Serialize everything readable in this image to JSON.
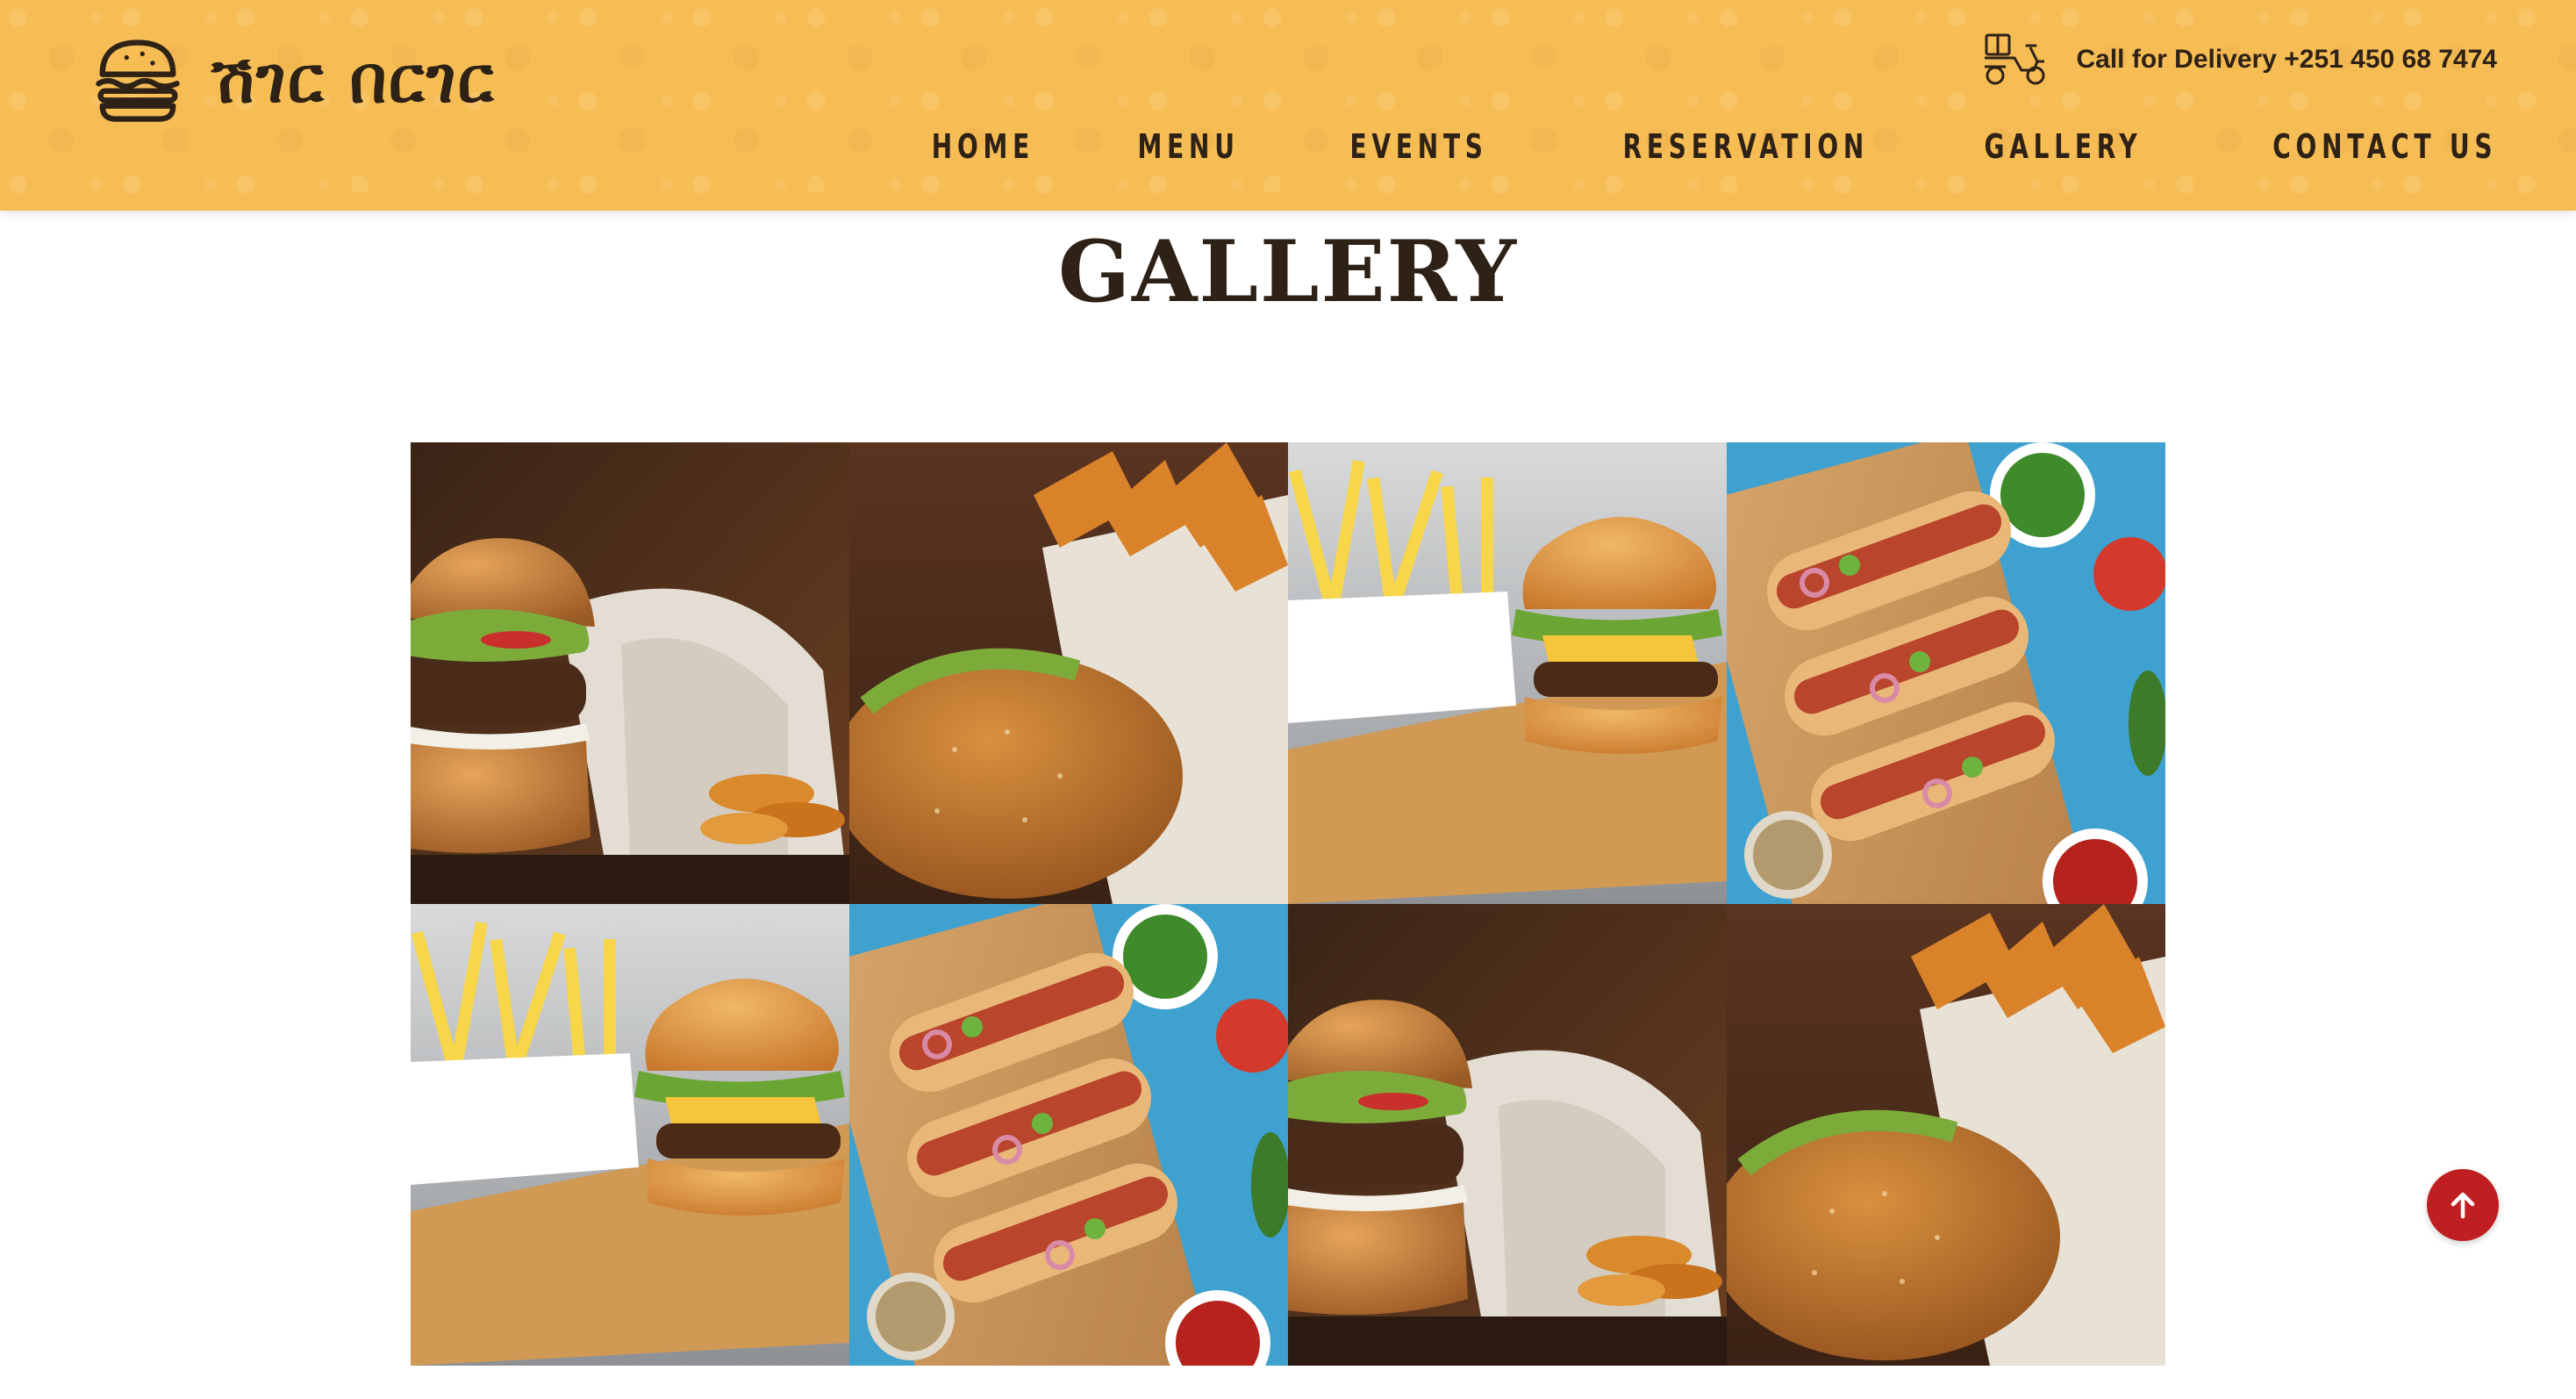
{
  "brand": {
    "name": "ሽገር በርገር",
    "logo_icon": "burger-icon"
  },
  "header": {
    "delivery_icon": "delivery-scooter-icon",
    "delivery_text": "Call for Delivery +251 450 68 7474"
  },
  "nav": {
    "items": [
      {
        "label": "HOME"
      },
      {
        "label": "MENU"
      },
      {
        "label": "EVENTS"
      },
      {
        "label": "RESERVATION"
      },
      {
        "label": "GALLERY"
      },
      {
        "label": "CONTACT US"
      }
    ]
  },
  "page": {
    "title": "GALLERY"
  },
  "gallery": {
    "images": [
      {
        "subject": "burger-with-potato-wedges"
      },
      {
        "subject": "burger-with-fries-in-paper"
      },
      {
        "subject": "cheeseburger-with-fries"
      },
      {
        "subject": "hot-dogs-on-board"
      },
      {
        "subject": "cheeseburger-with-fries"
      },
      {
        "subject": "hot-dogs-on-board"
      },
      {
        "subject": "burger-with-potato-wedges"
      },
      {
        "subject": "burger-with-fries-in-paper"
      }
    ]
  },
  "scroll_top": {
    "icon": "arrow-up-icon"
  },
  "colors": {
    "header_bg": "#f6bd55",
    "text_dark": "#2e2116",
    "accent_red": "#c01f22"
  }
}
